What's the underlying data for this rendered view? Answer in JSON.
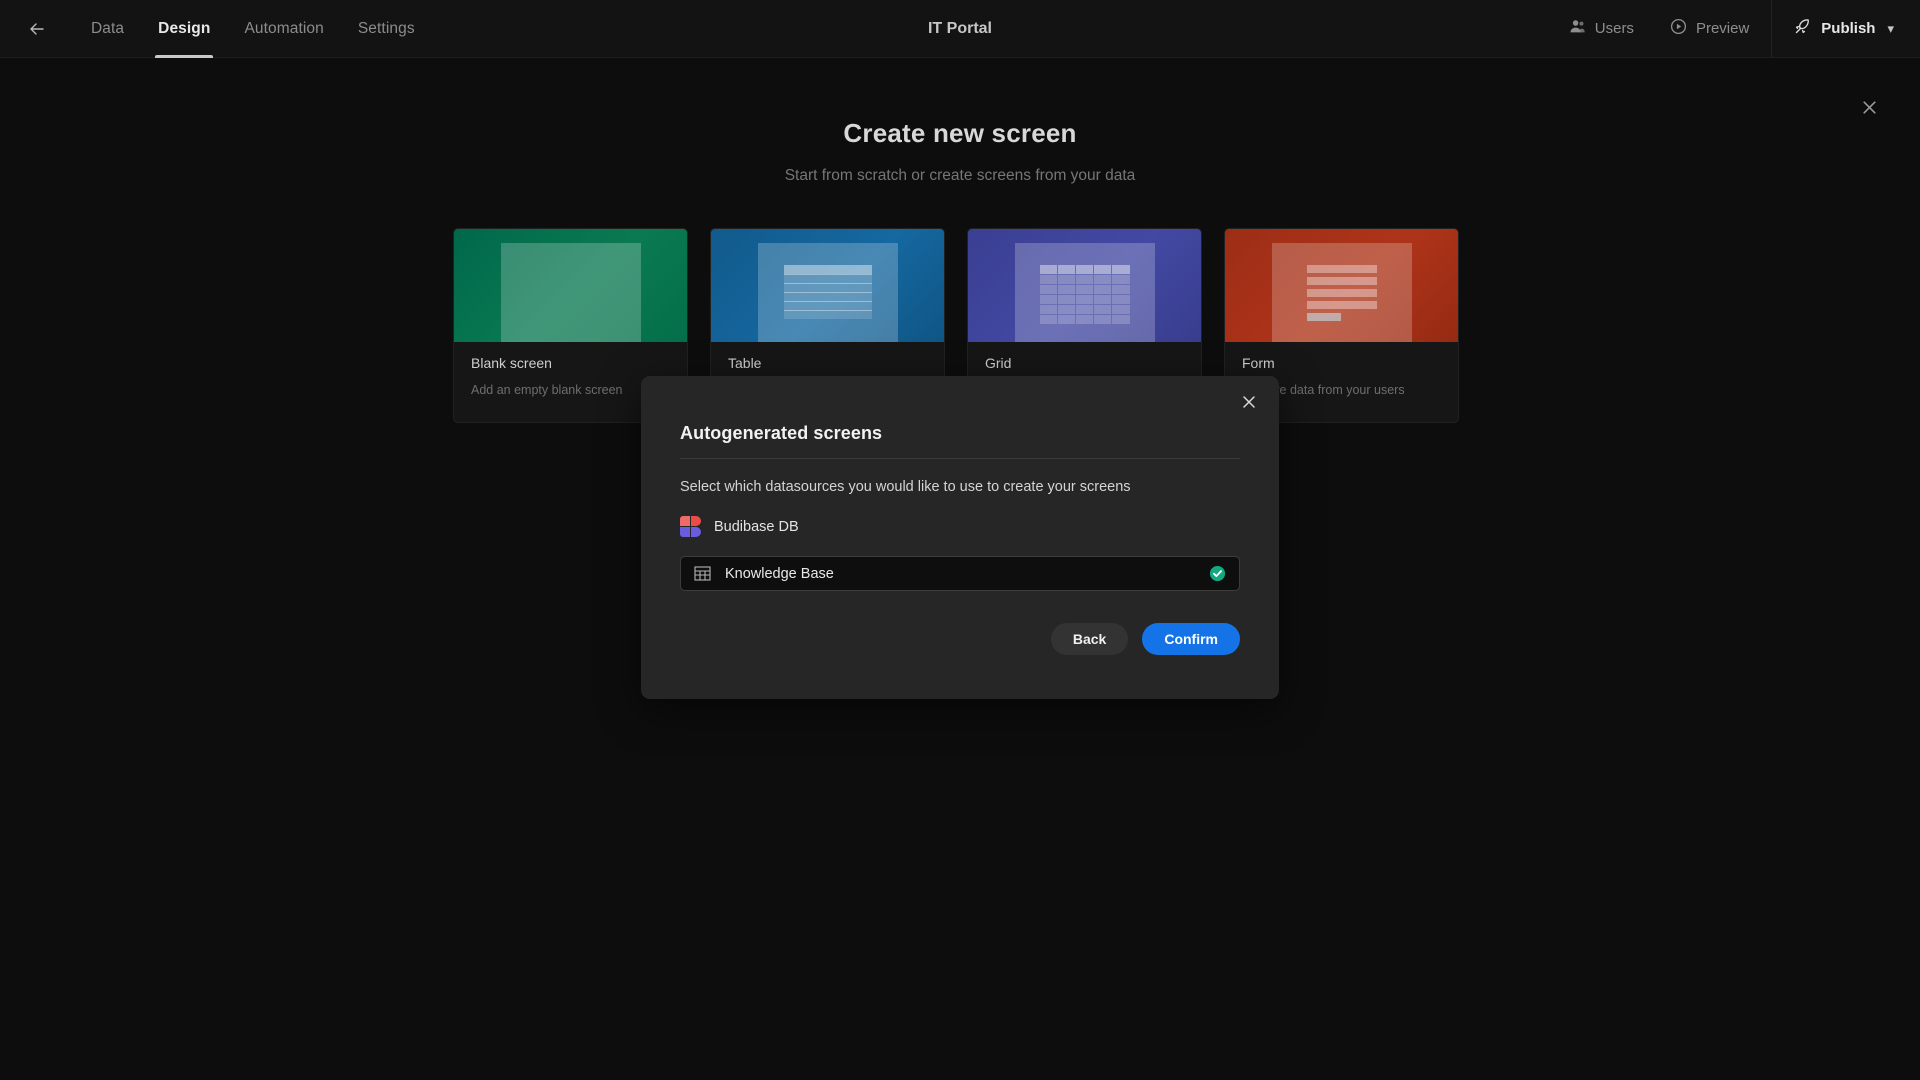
{
  "header": {
    "back_icon": "arrow-left-icon",
    "app_title": "IT Portal",
    "nav": [
      {
        "label": "Data",
        "active": false
      },
      {
        "label": "Design",
        "active": true
      },
      {
        "label": "Automation",
        "active": false
      },
      {
        "label": "Settings",
        "active": false
      }
    ],
    "users_label": "Users",
    "users_icon": "users-icon",
    "preview_label": "Preview",
    "preview_icon": "play-circle-icon",
    "publish_label": "Publish",
    "publish_icon": "rocket-icon",
    "publish_chevron_icon": "chevron-down-icon"
  },
  "page": {
    "close_icon": "close-icon",
    "title": "Create new screen",
    "subtitle": "Start from scratch or create screens from your data"
  },
  "cards": [
    {
      "title": "Blank screen",
      "subtitle": "Add an empty blank screen",
      "accent": "#00684a",
      "art": "blank"
    },
    {
      "title": "Table",
      "subtitle": "",
      "accent": "#115a8c",
      "art": "table"
    },
    {
      "title": "Grid",
      "subtitle": "",
      "accent": "#3a3f92",
      "art": "grid"
    },
    {
      "title": "Form",
      "subtitle": "Capture data from your users",
      "accent": "#9d2d16",
      "art": "form"
    }
  ],
  "modal": {
    "close_icon": "close-icon",
    "title": "Autogenerated screens",
    "description": "Select which datasources you would like to use to create your screens",
    "datasource": {
      "name": "Budibase DB",
      "logo_icon": "budibase-logo-icon"
    },
    "tables": [
      {
        "name": "Knowledge Base",
        "icon": "table-icon",
        "selected": true,
        "check_icon": "check-circle-icon",
        "check_color": "#13a87f"
      }
    ],
    "back_label": "Back",
    "confirm_label": "Confirm",
    "confirm_color": "#1473e6"
  }
}
